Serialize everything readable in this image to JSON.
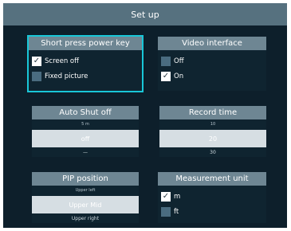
{
  "window": {
    "title": "Set up"
  },
  "panels": {
    "short_press": {
      "title": "Short press power key",
      "options": [
        {
          "label": "Screen off",
          "checked": true
        },
        {
          "label": "Fixed picture",
          "checked": false
        }
      ]
    },
    "video_interface": {
      "title": "Video interface",
      "options": [
        {
          "label": "Off",
          "checked": false
        },
        {
          "label": "On",
          "checked": true
        }
      ]
    },
    "auto_shut_off": {
      "title": "Auto Shut off",
      "items": {
        "above": "5 m",
        "selected": "off",
        "below": "—"
      }
    },
    "record_time": {
      "title": "Record time",
      "items": {
        "above": "10",
        "selected": "20",
        "below": "30"
      }
    },
    "pip_position": {
      "title": "PIP position",
      "items": {
        "above": "Upper left",
        "selected": "Upper Mid",
        "below": "Upper right"
      }
    },
    "measurement_unit": {
      "title": "Measurement unit",
      "options": [
        {
          "label": "m",
          "checked": true
        },
        {
          "label": "ft",
          "checked": false
        }
      ]
    }
  },
  "colors": {
    "background": "#0d1f2b",
    "header": "#56717f",
    "panel_header": "#6e8693",
    "focus": "#19c7d8",
    "checkbox_unchecked": "#4a6c80",
    "selected_row": "#d6dee3"
  }
}
